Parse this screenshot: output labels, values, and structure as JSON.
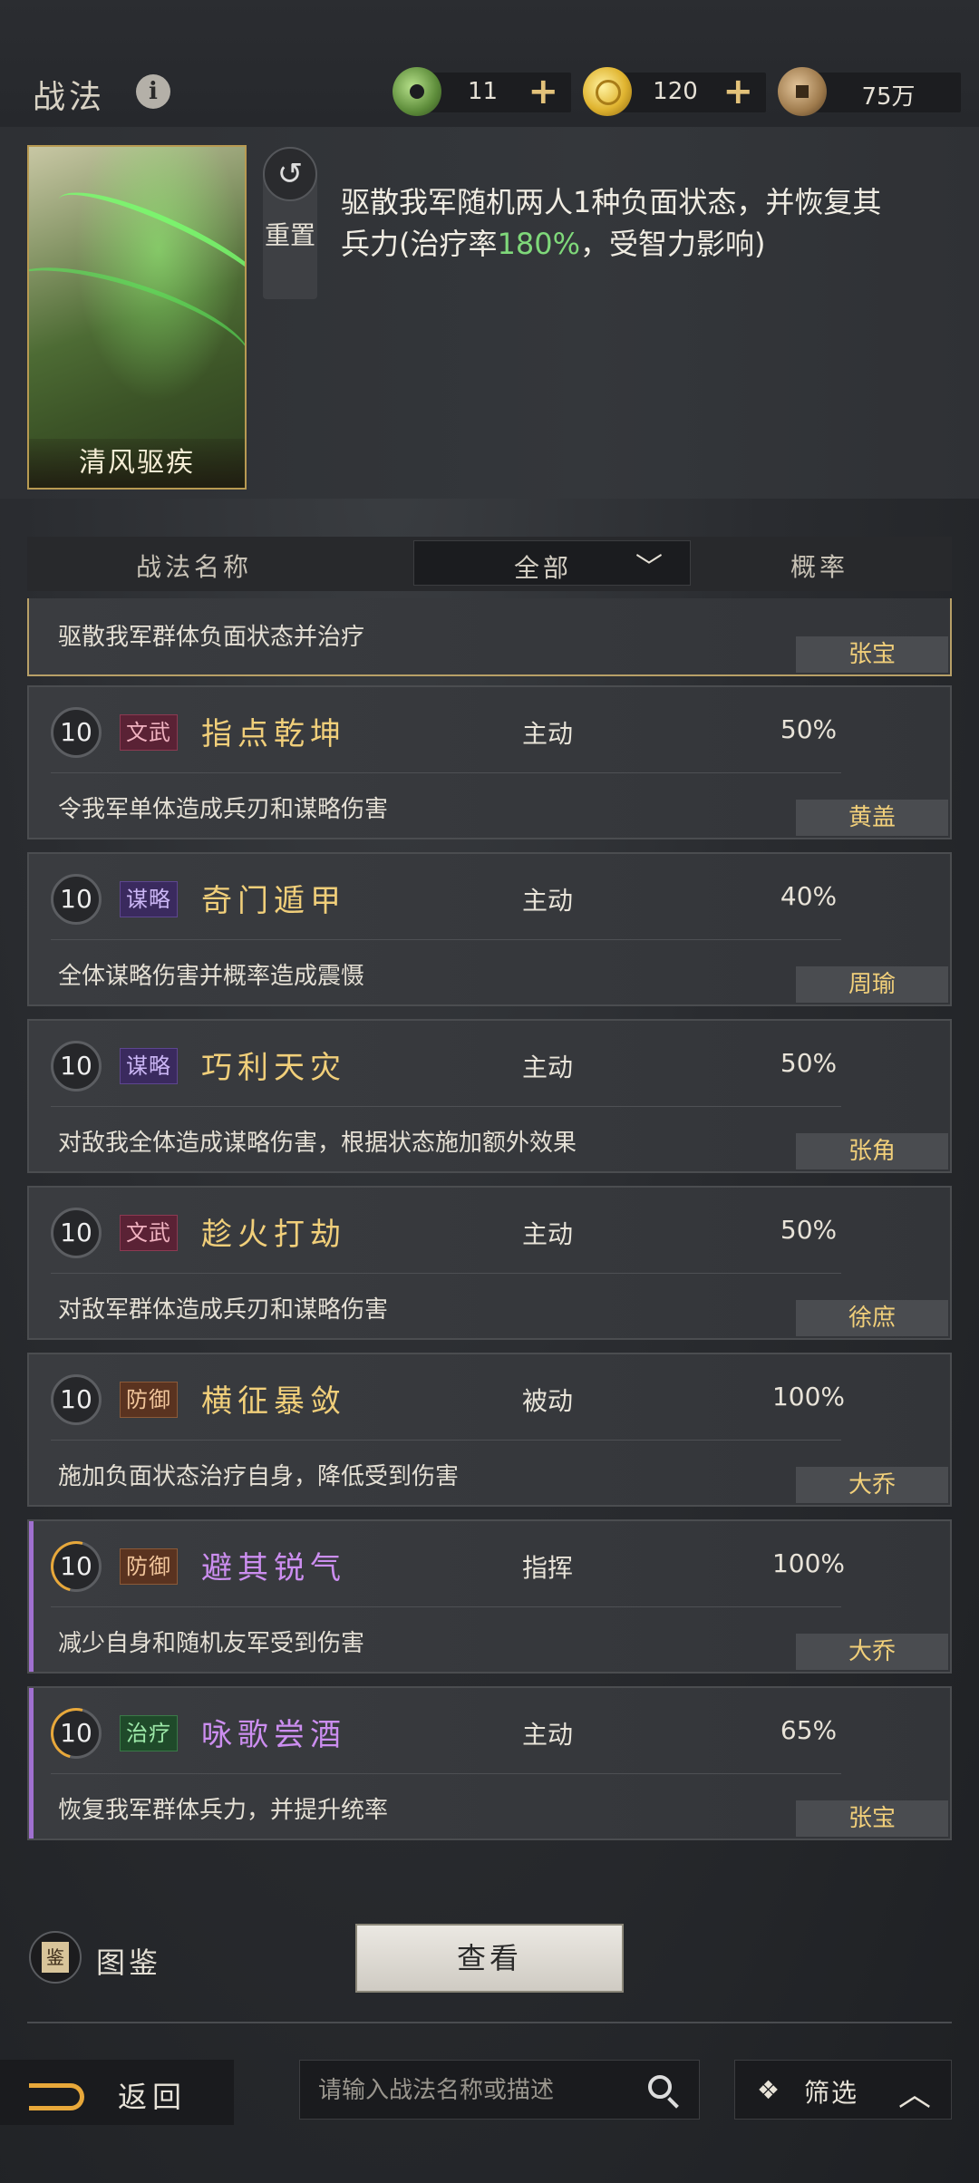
{
  "header": {
    "title": "战法",
    "info_icon": "i",
    "resources": [
      {
        "icon": "jade-coin-icon",
        "value": "11",
        "plus": "+"
      },
      {
        "icon": "gold-coin-icon",
        "value": "120",
        "plus": "+"
      },
      {
        "icon": "copper-coin-icon",
        "value": "75万"
      }
    ]
  },
  "detail": {
    "card_name": "清风驱疾",
    "reset_label": "重置",
    "reset_icon": "↺",
    "description_before": "驱散我军随机两人1种负面状态，并恢复其兵力(治疗率",
    "description_highlight": "180%",
    "description_after": "，受智力影响)",
    "highlight_color": "#7fd87a"
  },
  "filter": {
    "col_name": "战法名称",
    "dropdown_value": "全部",
    "col_prob": "概率"
  },
  "skills": [
    {
      "desc": "驱散我军群体负面状态并治疗",
      "hero": "张宝"
    },
    {
      "level": "10",
      "tag": "文武",
      "tag_class": "wenwu",
      "name": "指点乾坤",
      "name_color": "gold",
      "type": "主动",
      "prob": "50%",
      "desc": "令我军单体造成兵刃和谋略伤害",
      "hero": "黄盖"
    },
    {
      "level": "10",
      "tag": "谋略",
      "tag_class": "moulue",
      "name": "奇门遁甲",
      "name_color": "gold",
      "type": "主动",
      "prob": "40%",
      "desc": "全体谋略伤害并概率造成震慑",
      "hero": "周瑜"
    },
    {
      "level": "10",
      "tag": "谋略",
      "tag_class": "moulue",
      "name": "巧利天灾",
      "name_color": "gold",
      "type": "主动",
      "prob": "50%",
      "desc": "对敌我全体造成谋略伤害，根据状态施加额外效果",
      "hero": "张角"
    },
    {
      "level": "10",
      "tag": "文武",
      "tag_class": "wenwu",
      "name": "趁火打劫",
      "name_color": "gold",
      "type": "主动",
      "prob": "50%",
      "desc": "对敌军群体造成兵刃和谋略伤害",
      "hero": "徐庶"
    },
    {
      "level": "10",
      "tag": "防御",
      "tag_class": "fangyu",
      "name": "横征暴敛",
      "name_color": "gold",
      "type": "被动",
      "prob": "100%",
      "desc": "施加负面状态治疗自身，降低受到伤害",
      "hero": "大乔"
    },
    {
      "level": "10",
      "tag": "防御",
      "tag_class": "fangyu",
      "name": "避其锐气",
      "name_color": "purple",
      "type": "指挥",
      "prob": "100%",
      "desc": "减少自身和随机友军受到伤害",
      "hero": "大乔",
      "partial": true
    },
    {
      "level": "10",
      "tag": "治疗",
      "tag_class": "zhiliao",
      "name": "咏歌尝酒",
      "name_color": "purple",
      "type": "主动",
      "prob": "65%",
      "desc": "恢复我军群体兵力，并提升统率",
      "hero": "张宝",
      "partial": true
    }
  ],
  "footer": {
    "codex_label": "图鉴",
    "codex_icon_text": "鉴",
    "view_button": "查看",
    "back_label": "返回",
    "search_placeholder": "请输入战法名称或描述",
    "filter_label": "筛选",
    "filter_icon": "❖",
    "filter_chevron": "︿"
  }
}
